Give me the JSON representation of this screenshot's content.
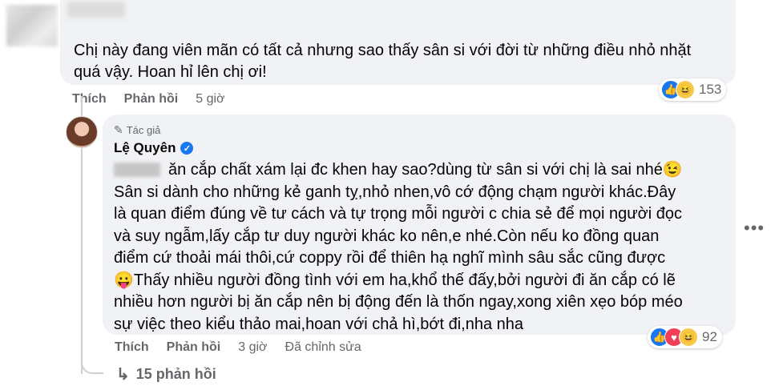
{
  "comment1": {
    "text": "Chị này đang viên mãn có tất cả nhưng sao thấy sân si với đời từ những điều nhỏ nhặt quá vậy. Hoan hỉ lên chị ơi!",
    "reaction_count": "153",
    "actions": {
      "like": "Thích",
      "reply": "Phản hồi",
      "time": "5 giờ"
    }
  },
  "reply": {
    "author_badge": "Tác giả",
    "author_name": "Lệ Quyên",
    "lines": [
      "ăn cắp chất xám lại đc khen hay sao?dùng từ sân si với chị là sai nhé😉",
      "Sân si dành cho những kẻ ganh tỵ,nhỏ nhen,vô cớ động chạm người khác.Đây",
      "là quan điểm đúng về tư cách và tự trọng mỗi người c chia sẻ để mọi người đọc",
      "và suy ngẫm,lấy cắp tư duy người khác ko nên,e nhé.Còn nếu ko đồng quan",
      "điểm cứ thoải mái thôi,cứ coppy rồi để thiên hạ nghĩ mình sâu sắc cũng được",
      "😛Thấy nhiều người đồng tình với em ha,khổ thế đấy,bởi người đi ăn cắp có lẽ",
      "nhiều hơn người bị ăn cắp nên bị động đến là thốn ngay,xong xiên xẹo bóp méo",
      "sự việc theo kiểu thảo mai,hoan với chả hì,bớt đi,nha nha"
    ],
    "reaction_count": "92",
    "actions": {
      "like": "Thích",
      "reply": "Phản hồi",
      "time": "3 giờ",
      "edited": "Đã chỉnh sửa"
    }
  },
  "more_replies": "15 phản hồi",
  "icons": {
    "like": "👍",
    "haha": "😆",
    "love": "♥",
    "pen": "✎",
    "check": "✓",
    "arrow": "↳",
    "more": "•••"
  },
  "colors": {
    "bubble": "#f0f2f5",
    "meta": "#65676b",
    "like_blue": "#1877f2",
    "love_red": "#f33e58"
  }
}
